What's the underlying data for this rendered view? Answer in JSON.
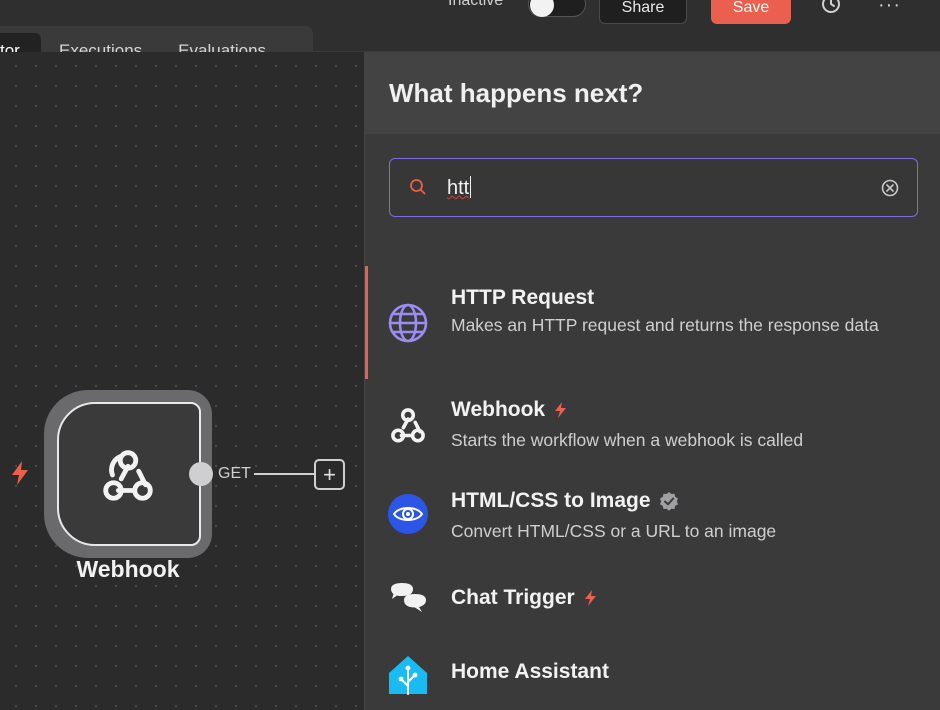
{
  "header": {
    "status_label": "Inactive",
    "share_label": "Share",
    "save_label": "Save"
  },
  "tabs": [
    {
      "label": "tor"
    },
    {
      "label": "Executions"
    },
    {
      "label": "Evaluations"
    }
  ],
  "canvas": {
    "node": {
      "label": "Webhook",
      "output_label": "GET"
    }
  },
  "panel": {
    "title": "What happens next?",
    "search": {
      "value": "htt"
    },
    "results": [
      {
        "title": "HTTP Request",
        "description": "Makes an HTTP request and returns the response data",
        "icon": "globe-icon",
        "badge": ""
      },
      {
        "title": "Webhook",
        "description": "Starts the workflow when a webhook is called",
        "icon": "webhook-icon",
        "badge": "trigger-bolt"
      },
      {
        "title": "HTML/CSS to Image",
        "description": "Convert HTML/CSS or a URL to an image",
        "icon": "htmlcss-eye-icon",
        "badge": "verified"
      },
      {
        "title": "Chat Trigger",
        "description": "",
        "icon": "chat-bubbles-icon",
        "badge": "trigger-bolt"
      },
      {
        "title": "Home Assistant",
        "description": "",
        "icon": "home-assistant-icon",
        "badge": ""
      }
    ]
  },
  "colors": {
    "accent": "#ea5f4d",
    "focus_border": "#7c6ce0",
    "http_globe": "#9b8cf2",
    "htmlcss_blue": "#2b56e8",
    "home_assistant": "#18bcf2"
  }
}
